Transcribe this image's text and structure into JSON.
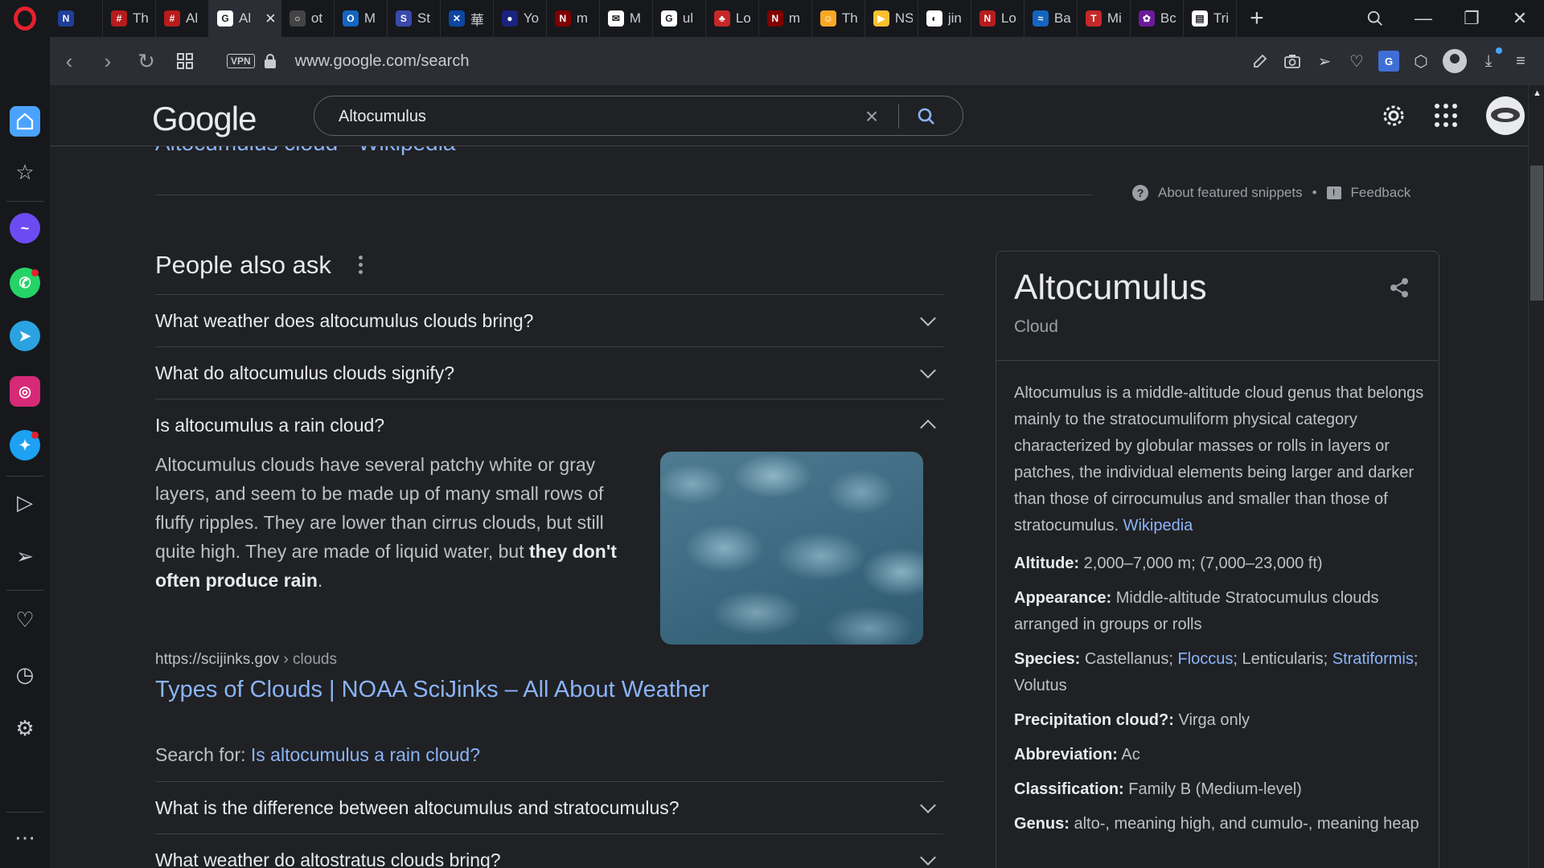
{
  "browser": {
    "tabs": [
      {
        "title": "",
        "icon_color": "#1e3f9a",
        "glyph": "N"
      },
      {
        "title": "Th",
        "icon_color": "#b71c1c",
        "glyph": "#"
      },
      {
        "title": "Al",
        "icon_color": "#b71c1c",
        "glyph": "#"
      },
      {
        "title": "Al",
        "icon_color": "#ffffff",
        "glyph": "G",
        "active": true
      },
      {
        "title": "ot",
        "icon_color": "#444444",
        "glyph": "○"
      },
      {
        "title": "M",
        "icon_color": "#1565c0",
        "glyph": "O"
      },
      {
        "title": "St",
        "icon_color": "#3949ab",
        "glyph": "S"
      },
      {
        "title": "華",
        "icon_color": "#0d47a1",
        "glyph": "✕"
      },
      {
        "title": "Yo",
        "icon_color": "#1a237e",
        "glyph": "●"
      },
      {
        "title": "m",
        "icon_color": "#7f0000",
        "glyph": "N"
      },
      {
        "title": "M",
        "icon_color": "#ffffff",
        "glyph": "✉"
      },
      {
        "title": "ul",
        "icon_color": "#ffffff",
        "glyph": "G"
      },
      {
        "title": "Lo",
        "icon_color": "#c62828",
        "glyph": "♣"
      },
      {
        "title": "m",
        "icon_color": "#7f0000",
        "glyph": "N"
      },
      {
        "title": "Th",
        "icon_color": "#f9a825",
        "glyph": "☺"
      },
      {
        "title": "NS",
        "icon_color": "#fbc02d",
        "glyph": "▶"
      },
      {
        "title": "jin",
        "icon_color": "#ffffff",
        "glyph": "◐"
      },
      {
        "title": "Lo",
        "icon_color": "#b71c1c",
        "glyph": "N"
      },
      {
        "title": "Ba",
        "icon_color": "#1565c0",
        "glyph": "≈"
      },
      {
        "title": "Mi",
        "icon_color": "#c62828",
        "glyph": "T"
      },
      {
        "title": "Bc",
        "icon_color": "#6a1b9a",
        "glyph": "✿"
      },
      {
        "title": "Tri",
        "icon_color": "#ffffff",
        "glyph": "▤"
      }
    ],
    "url": "www.google.com/search",
    "vpn_label": "VPN",
    "translate_label": "G"
  },
  "google": {
    "logo": "Google",
    "query": "Altocumulus",
    "snippet_link": "Altocumulus cloud - Wikipedia",
    "about_snippets": "About featured snippets",
    "separator": "•",
    "feedback": "Feedback",
    "paa_title": "People also ask",
    "questions_top": [
      "What weather does altocumulus clouds bring?",
      "What do altocumulus clouds signify?",
      "Is altocumulus a rain cloud?"
    ],
    "answer_text": "Altocumulus clouds have several patchy white or gray layers, and seem to be made up of many small rows of fluffy ripples. They are lower than cirrus clouds, but still quite high. They are made of liquid water, but ",
    "answer_bold": "they don't often produce rain",
    "answer_end": ".",
    "source_url": "https://scijinks.gov",
    "source_path": " › clouds",
    "source_title": "Types of Clouds | NOAA SciJinks – All About Weather",
    "search_for_label": "Search for: ",
    "search_for_link": "Is altocumulus a rain cloud?",
    "questions_bottom": [
      "What is the difference between altocumulus and stratocumulus?",
      "What weather do altostratus clouds bring?"
    ]
  },
  "knowledge_panel": {
    "title": "Altocumulus",
    "subtitle": "Cloud",
    "description": "Altocumulus is a middle-altitude cloud genus that belongs mainly to the stratocumuliform physical category characterized by globular masses or rolls in layers or patches, the individual elements being larger and darker than those of cirrocumulus and smaller than those of stratocumulus. ",
    "source_link": "Wikipedia",
    "facts": {
      "altitude_label": "Altitude:",
      "altitude_value": " 2,000–7,000 m; (7,000–23,000 ft)",
      "appearance_label": "Appearance:",
      "appearance_value": " Middle-altitude Stratocumulus clouds arranged in groups or rolls",
      "species_label": "Species:",
      "species_1": " Castellanus; ",
      "species_2": "Floccus",
      "species_3": "; Lenticularis; ",
      "species_4": "Stratiformis",
      "species_5": "; Volutus",
      "precip_label": "Precipitation cloud?:",
      "precip_value": " Virga only",
      "abbr_label": "Abbreviation:",
      "abbr_value": " Ac",
      "class_label": "Classification:",
      "class_value": " Family B (Medium-level)",
      "genus_label": "Genus:",
      "genus_value": " alto-, meaning high, and cumulo-, meaning heap"
    }
  },
  "icons": {
    "close": "×",
    "plus": "+",
    "search": "⌕",
    "minimize": "—",
    "restore": "❐",
    "win_close": "✕",
    "back": "‹",
    "forward": "›",
    "reload": "↻",
    "home": "⌂",
    "star": "☆",
    "heart": "♡",
    "clock": "◷",
    "gear": "⚙",
    "play": "▷",
    "send": "➢",
    "more": "⋯",
    "snapshot": "⌗",
    "cube": "⬡",
    "download": "⤓",
    "menu": "≡",
    "clear": "×"
  },
  "colors": {
    "link": "#8ab4f8",
    "background": "#202124",
    "opera_red": "#e3212d",
    "accent": "#4ba3ff"
  }
}
